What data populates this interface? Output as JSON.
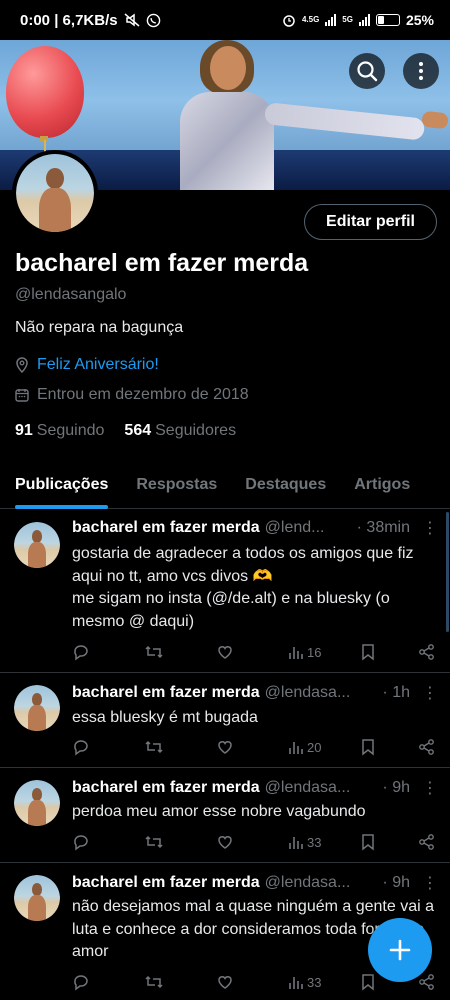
{
  "status_bar": {
    "time_speed": "0:00 | 6,7KB/s",
    "network1": "4.5G",
    "network2": "5G",
    "battery": "25%"
  },
  "header": {
    "search_icon": "search-icon",
    "more_icon": "more-vertical-icon"
  },
  "profile": {
    "edit_button": "Editar perfil",
    "name": "bacharel em fazer merda",
    "handle": "@lendasangalo",
    "bio": "Não repara na bagunça",
    "location": "Feliz Aniversário!",
    "joined": "Entrou em dezembro de 2018",
    "following_count": "91",
    "following_label": "Seguindo",
    "followers_count": "564",
    "followers_label": "Seguidores"
  },
  "tabs": [
    {
      "label": "Publicações",
      "active": true
    },
    {
      "label": "Respostas",
      "active": false
    },
    {
      "label": "Destaques",
      "active": false
    },
    {
      "label": "Artigos",
      "active": false
    }
  ],
  "tweets": [
    {
      "name": "bacharel em fazer merda",
      "handle": "@lend...",
      "time": "· 38min",
      "text": "gostaria de agradecer a todos os amigos que fiz aqui no tt, amo vcs divos 🫶\nme sigam no insta (@/de.alt) e na bluesky (o mesmo @ daqui)",
      "views": "16"
    },
    {
      "name": "bacharel em fazer merda",
      "handle": "@lendasa...",
      "time": "· 1h",
      "text": "essa bluesky é mt bugada",
      "views": "20"
    },
    {
      "name": "bacharel em fazer merda",
      "handle": "@lendasa...",
      "time": "· 9h",
      "text": "perdoa meu amor esse nobre vagabundo",
      "views": "33"
    },
    {
      "name": "bacharel em fazer merda",
      "handle": "@lendasa...",
      "time": "· 9h",
      "text": "não desejamos mal a quase ninguém a gente vai a luta e conhece a dor consideramos toda forma de amor",
      "views": "33"
    }
  ],
  "fab": {
    "icon": "plus-icon"
  },
  "colors": {
    "accent": "#1d9bf0",
    "background": "#000000",
    "secondary_text": "#71767b"
  }
}
